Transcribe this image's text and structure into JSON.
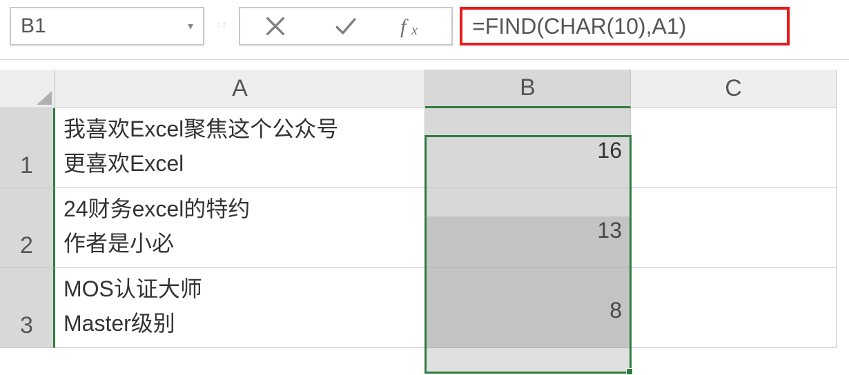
{
  "nameBox": {
    "value": "B1"
  },
  "formulaBar": {
    "value": "=FIND(CHAR(10),A1)"
  },
  "columns": {
    "A": "A",
    "B": "B",
    "C": "C"
  },
  "rows": [
    {
      "num": "1",
      "A": {
        "line1": "我喜欢Excel聚焦这个公众号",
        "line2": "更喜欢Excel"
      },
      "B": "16",
      "C": ""
    },
    {
      "num": "2",
      "A": {
        "line1": "24财务excel的特约",
        "line2": "作者是小必"
      },
      "B": "13",
      "C": ""
    },
    {
      "num": "3",
      "A": {
        "line1": "MOS认证大师",
        "line2": "Master级别"
      },
      "B": "8",
      "C": ""
    }
  ]
}
